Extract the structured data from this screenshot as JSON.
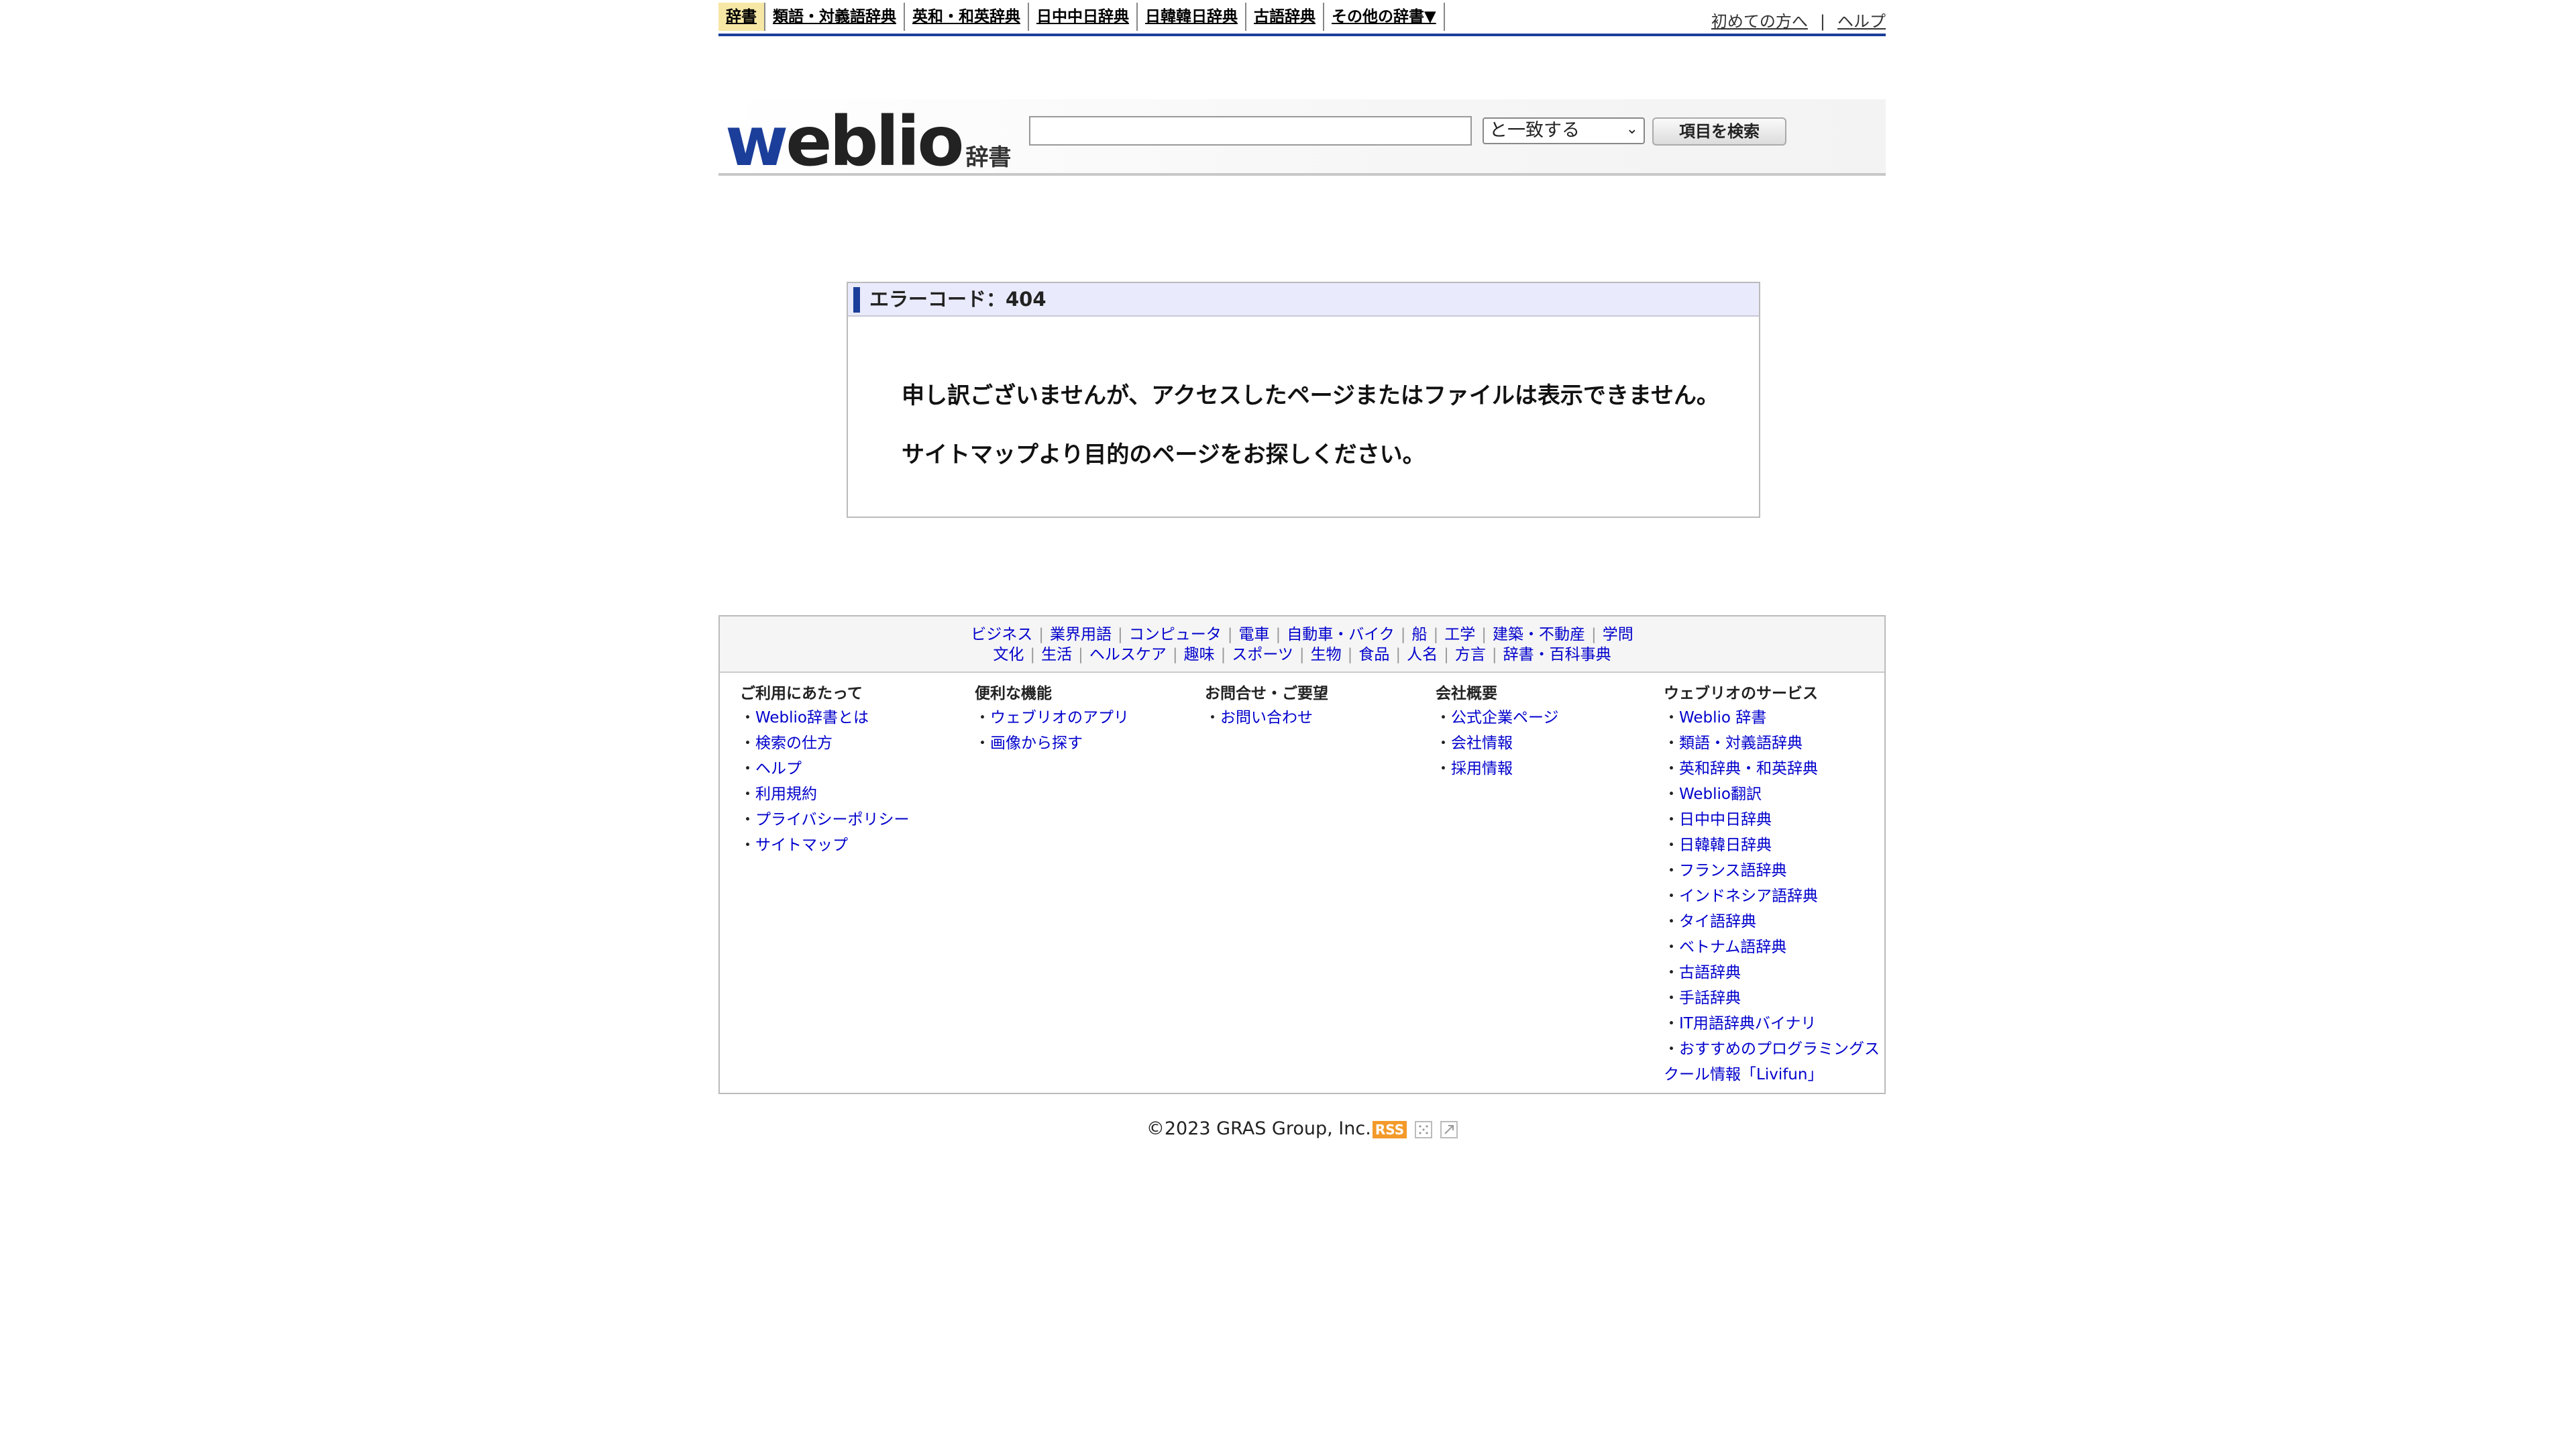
{
  "topnav": {
    "tabs": [
      {
        "label": "辞書",
        "active": true
      },
      {
        "label": "類語・対義語辞典"
      },
      {
        "label": "英和・和英辞典"
      },
      {
        "label": "日中中日辞典"
      },
      {
        "label": "日韓韓日辞典"
      },
      {
        "label": "古語辞典"
      },
      {
        "label": "その他の辞書▼"
      }
    ],
    "links": {
      "first": "初めての方へ",
      "separator": "|",
      "help": "ヘルプ"
    }
  },
  "header": {
    "logo_w": "w",
    "logo_rest": "eblio",
    "logo_suffix": "辞書",
    "search": {
      "value": "",
      "placeholder": ""
    },
    "match_select": "と一致する",
    "search_button": "項目を検索"
  },
  "error": {
    "title": "エラーコード：404",
    "message1": "申し訳ございませんが、アクセスしたページまたはファイルは表示できません。",
    "message2": "サイトマップより目的のページをお探しください。"
  },
  "footer": {
    "categories_row1": [
      "ビジネス",
      "業界用語",
      "コンピュータ",
      "電車",
      "自動車・バイク",
      "船",
      "工学",
      "建築・不動産",
      "学問"
    ],
    "categories_row2": [
      "文化",
      "生活",
      "ヘルスケア",
      "趣味",
      "スポーツ",
      "生物",
      "食品",
      "人名",
      "方言",
      "辞書・百科事典"
    ],
    "columns": [
      {
        "title": "ご利用にあたって",
        "items": [
          "Weblio辞書とは",
          "検索の仕方",
          "ヘルプ",
          "利用規約",
          "プライバシーポリシー",
          "サイトマップ"
        ]
      },
      {
        "title": "便利な機能",
        "items": [
          "ウェブリオのアプリ",
          "画像から探す"
        ]
      },
      {
        "title": "お問合せ・ご要望",
        "items": [
          "お問い合わせ"
        ]
      },
      {
        "title": "会社概要",
        "items": [
          "公式企業ページ",
          "会社情報",
          "採用情報"
        ]
      },
      {
        "title": "ウェブリオのサービス",
        "items": [
          "Weblio 辞書",
          "類語・対義語辞典",
          "英和辞典・和英辞典",
          "Weblio翻訳",
          "日中中日辞典",
          "日韓韓日辞典",
          "フランス語辞典",
          "インドネシア語辞典",
          "タイ語辞典",
          "ベトナム語辞典",
          "古語辞典",
          "手話辞典",
          "IT用語辞典バイナリ",
          "おすすめのプログラミングスクール情報「Livifun」"
        ]
      }
    ],
    "copyright": "©2023 GRAS Group, Inc.",
    "rss": "RSS"
  },
  "colors": {
    "brand_blue": "#1b3e9a",
    "active_tab": "#f6e7a5",
    "link": "#0000cc",
    "rss_orange": "#f39a2a"
  }
}
